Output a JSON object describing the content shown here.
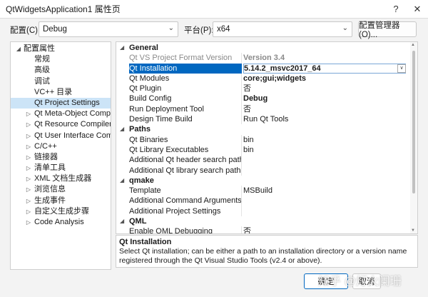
{
  "window": {
    "title": "QtWidgetsApplication1 属性页",
    "help_icon": "?",
    "close_icon": "✕"
  },
  "config": {
    "label": "配置(C):",
    "value": "Debug",
    "platform_label": "平台(P):",
    "platform_value": "x64",
    "manager_button": "配置管理器(O)..."
  },
  "tree": {
    "items": [
      {
        "label": "配置属性",
        "expander": "◢"
      },
      {
        "label": "常规"
      },
      {
        "label": "高级"
      },
      {
        "label": "调试"
      },
      {
        "label": "VC++ 目录"
      },
      {
        "label": "Qt Project Settings"
      },
      {
        "label": "Qt Meta-Object Compile",
        "expander": "▷"
      },
      {
        "label": "Qt Resource Compiler",
        "expander": "▷"
      },
      {
        "label": "Qt User Interface Comp",
        "expander": "▷"
      },
      {
        "label": "C/C++",
        "expander": "▷"
      },
      {
        "label": "链接器",
        "expander": "▷"
      },
      {
        "label": "清单工具",
        "expander": "▷"
      },
      {
        "label": "XML 文档生成器",
        "expander": "▷"
      },
      {
        "label": "浏览信息",
        "expander": "▷"
      },
      {
        "label": "生成事件",
        "expander": "▷"
      },
      {
        "label": "自定义生成步骤",
        "expander": "▷"
      },
      {
        "label": "Code Analysis",
        "expander": "▷"
      }
    ]
  },
  "grid": {
    "rows": [
      {
        "name": "General",
        "value": "",
        "expander": "◢"
      },
      {
        "name": "Qt VS Project Format Version",
        "value": "Version 3.4"
      },
      {
        "name": "Qt Installation",
        "value": "5.14.2_msvc2017_64"
      },
      {
        "name": "Qt Modules",
        "value": "core;gui;widgets"
      },
      {
        "name": "Qt Plugin",
        "value": "否"
      },
      {
        "name": "Build Config",
        "value": "Debug"
      },
      {
        "name": "Run Deployment Tool",
        "value": "否"
      },
      {
        "name": "Design Time Build",
        "value": "Run Qt Tools"
      },
      {
        "name": "Paths",
        "value": "",
        "expander": "◢"
      },
      {
        "name": "Qt Binaries",
        "value": "bin"
      },
      {
        "name": "Qt Library Executables",
        "value": "bin"
      },
      {
        "name": "Additional Qt header search paths",
        "value": ""
      },
      {
        "name": "Additional Qt library search paths",
        "value": ""
      },
      {
        "name": "qmake",
        "value": "",
        "expander": "◢"
      },
      {
        "name": "Template",
        "value": "MSBuild"
      },
      {
        "name": "Additional Command Arguments",
        "value": ""
      },
      {
        "name": "Additional Project Settings",
        "value": ""
      },
      {
        "name": "QML",
        "value": "",
        "expander": "◢"
      },
      {
        "name": "Enable QML Debugging",
        "value": "否"
      }
    ],
    "dropdown_icon": "∨"
  },
  "description": {
    "title": "Qt Installation",
    "text": "Select Qt installation; can be either a path to an installation directory or a version name registered through the Qt Visual Studio Tools (v2.4 or above)."
  },
  "buttons": {
    "ok": "确定",
    "cancel": "取消"
  },
  "watermark": "知乎 @灯火阑珊"
}
